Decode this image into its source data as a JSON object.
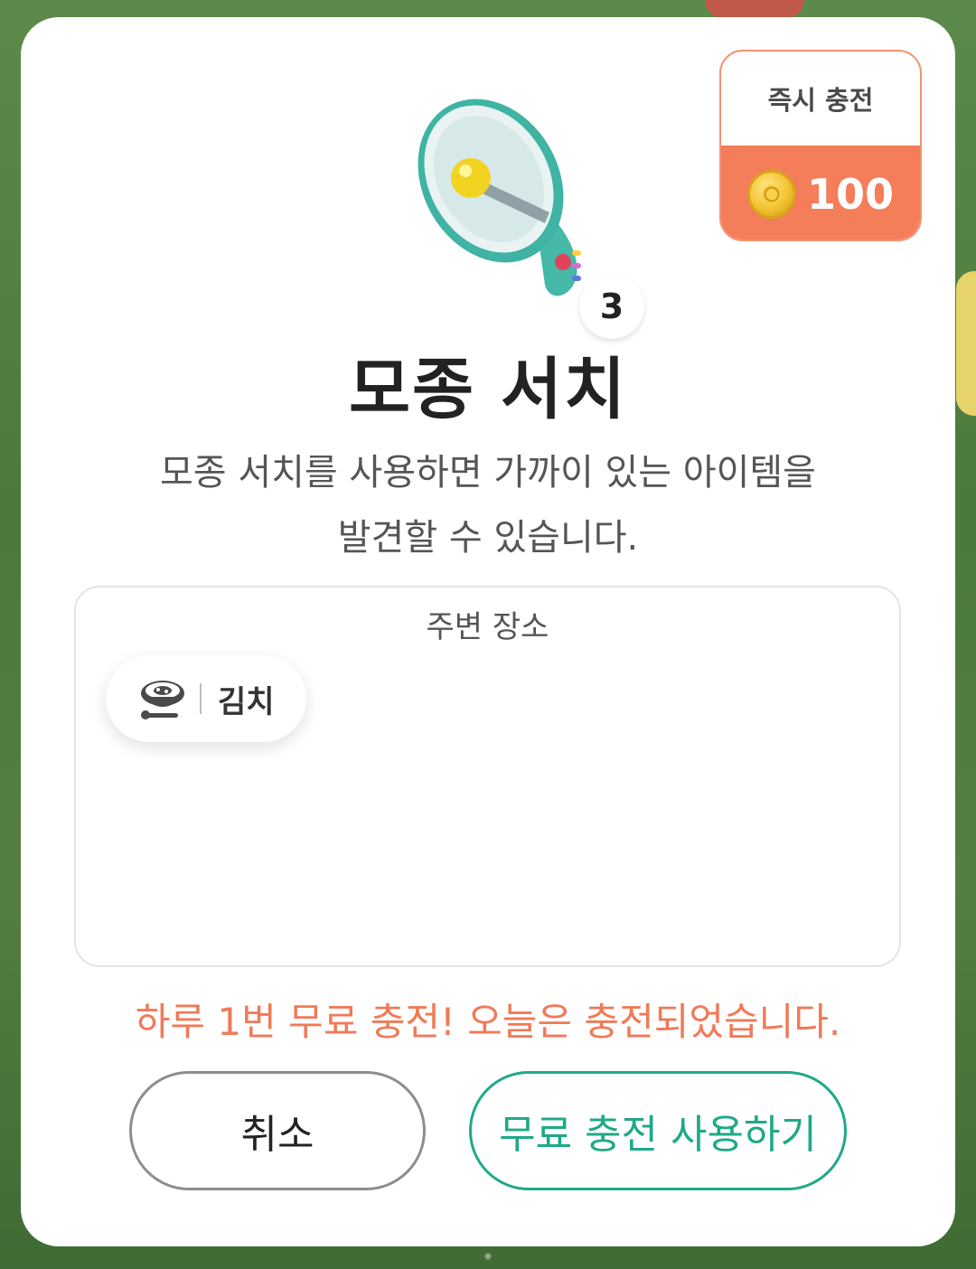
{
  "charge_badge": {
    "title": "즉시 충전",
    "amount": "100",
    "icon": "coin-icon"
  },
  "item": {
    "icon": "megaphone-icon",
    "count": "3",
    "title": "모종 서치",
    "description_line1": "모종 서치를 사용하면 가까이 있는 아이템을",
    "description_line2": "발견할 수 있습니다."
  },
  "nearby": {
    "title": "주변 장소",
    "places": [
      {
        "icon": "kimchi-bowl-icon",
        "label": "김치"
      }
    ]
  },
  "notice": "하루 1번 무료 충전! 오늘은 충전되었습니다.",
  "buttons": {
    "cancel": "취소",
    "use_free_charge": "무료 충전 사용하기"
  },
  "colors": {
    "accent_orange": "#f47d5a",
    "accent_green": "#1fa988",
    "dialog_bg": "#ffffff"
  }
}
